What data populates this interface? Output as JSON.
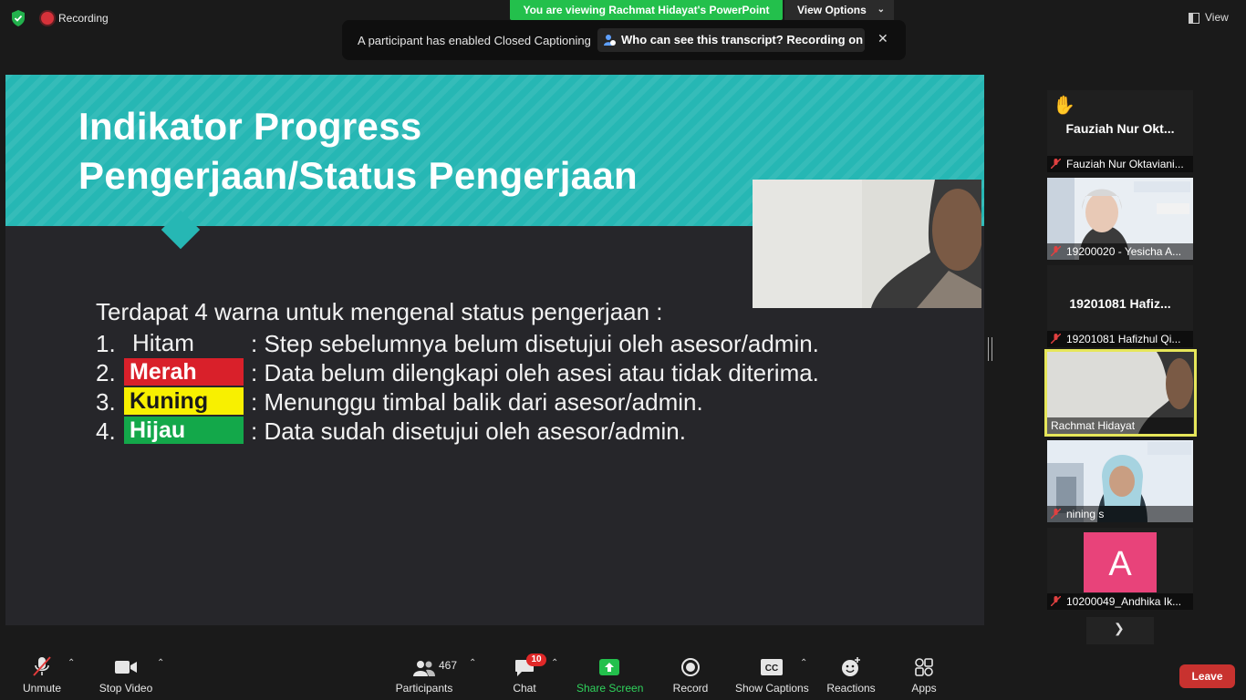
{
  "topbar": {
    "recording_label": "Recording",
    "viewing_banner": "You are viewing Rachmat Hidayat's PowerPoint",
    "view_options_label": "View Options",
    "view_label": "View"
  },
  "cc_notice": {
    "message": "A participant has enabled Closed Captioning",
    "who_label": "Who can see this transcript? Recording on"
  },
  "slide": {
    "title": "Indikator Progress Pengerjaan/Status Pengerjaan",
    "intro": "Terdapat 4 warna untuk mengenal status pengerjaan :",
    "items": [
      {
        "num": "1.",
        "label": "Hitam",
        "desc": ": Step sebelumnya belum disetujui oleh asesor/admin.",
        "color": "",
        "text_color": "#f2f2f2"
      },
      {
        "num": "2.",
        "label": "Merah",
        "desc": ": Data belum dilengkapi oleh asesi atau tidak diterima.",
        "color": "#d9202a",
        "text_color": "#ffffff"
      },
      {
        "num": "3.",
        "label": "Kuning",
        "desc": ": Menunggu timbal balik dari asesor/admin.",
        "color": "#f8f000",
        "text_color": "#1a1a1a"
      },
      {
        "num": "4.",
        "label": "Hijau",
        "desc": ": Data sudah disetujui oleh asesor/admin.",
        "color": "#13a84a",
        "text_color": "#ffffff"
      }
    ],
    "header_color": "#26b7b4"
  },
  "participants_panel": [
    {
      "display": "Fauziah Nur Okt...",
      "name": "Fauziah Nur Oktaviani...",
      "kind": "name-only",
      "raised_hand": true
    },
    {
      "display": "",
      "name": "19200020 - Yesicha A...",
      "kind": "video"
    },
    {
      "display": "19201081 Hafiz...",
      "name": "19201081 Hafizhul Qi...",
      "kind": "name-only"
    },
    {
      "display": "",
      "name": "Rachmat Hidayat",
      "kind": "video-active"
    },
    {
      "display": "",
      "name": "nining s",
      "kind": "video"
    },
    {
      "display": "A",
      "name": "10200049_Andhika Ik...",
      "kind": "avatar"
    }
  ],
  "toolbar": {
    "unmute": "Unmute",
    "stop_video": "Stop Video",
    "participants": "Participants",
    "participants_count": "467",
    "chat": "Chat",
    "chat_badge": "10",
    "share_screen": "Share Screen",
    "record": "Record",
    "show_captions": "Show Captions",
    "reactions": "Reactions",
    "apps": "Apps",
    "leave": "Leave"
  }
}
